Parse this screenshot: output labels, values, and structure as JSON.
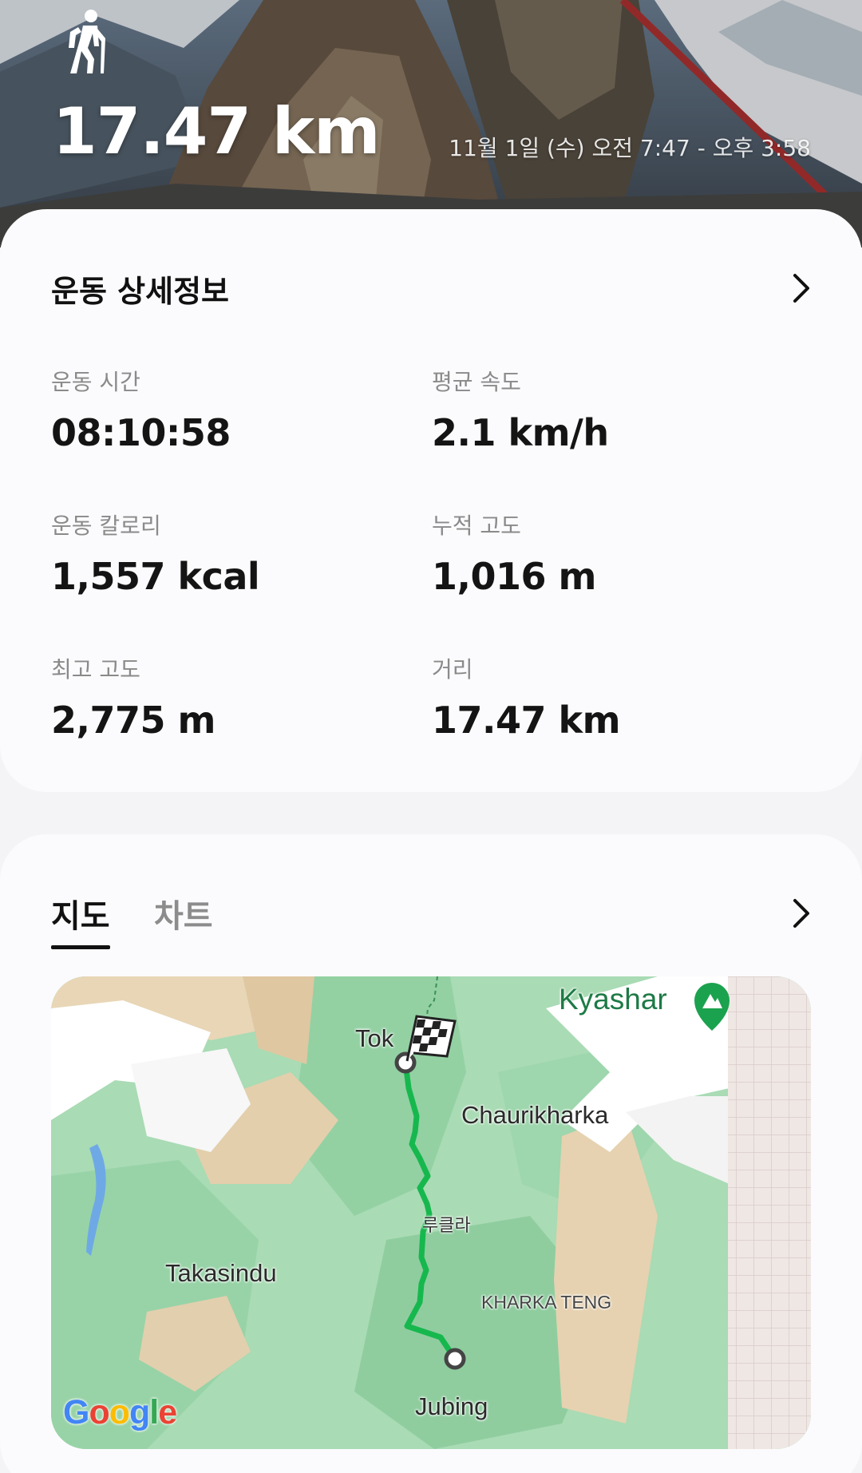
{
  "header": {
    "activity_icon": "hiking-icon",
    "distance": "17.47 km",
    "time_range": "11월 1일 (수) 오전 7:47 - 오후 3:58"
  },
  "details": {
    "title": "운동 상세정보",
    "stats": [
      {
        "label": "운동 시간",
        "value": "08:10:58"
      },
      {
        "label": "평균 속도",
        "value": "2.1 km/h"
      },
      {
        "label": "운동 칼로리",
        "value": "1,557 kcal"
      },
      {
        "label": "누적 고도",
        "value": "1,016 m"
      },
      {
        "label": "최고 고도",
        "value": "2,775 m"
      },
      {
        "label": "거리",
        "value": "17.47 km"
      }
    ]
  },
  "map_section": {
    "tabs": [
      {
        "label": "지도",
        "active": true
      },
      {
        "label": "차트",
        "active": false
      }
    ],
    "labels": {
      "kyashar": "Kyashar",
      "tok": "Tok",
      "chaurikharka": "Chaurikharka",
      "lukla": "루클라",
      "takasindu": "Takasindu",
      "kharka_teng": "KHARKA TENG",
      "jubing": "Jubing"
    },
    "attribution": [
      "G",
      "o",
      "o",
      "g",
      "l",
      "e"
    ]
  },
  "colors": {
    "route": "#16b84e",
    "map_green": "#a9dbb4",
    "map_forest": "#8fd0a0",
    "map_tan": "#e7d4b4",
    "map_snow": "#ffffff",
    "google": [
      "#4285F4",
      "#EA4335",
      "#FBBC05",
      "#4285F4",
      "#34A853",
      "#EA4335"
    ]
  }
}
